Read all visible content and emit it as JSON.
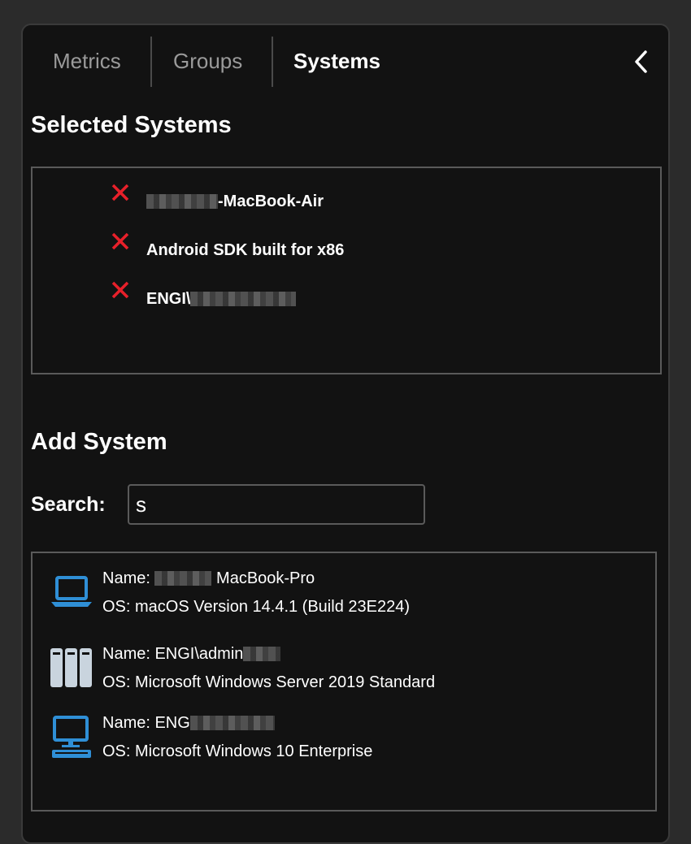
{
  "tabs": [
    {
      "label": "Metrics",
      "active": false
    },
    {
      "label": "Groups",
      "active": false
    },
    {
      "label": "Systems",
      "active": true
    }
  ],
  "selected": {
    "title": "Selected Systems",
    "items": [
      {
        "prefix": "",
        "suffix": "-MacBook-Air"
      },
      {
        "prefix": "Android SDK built for x86",
        "suffix": ""
      },
      {
        "prefix": "ENGI\\",
        "suffix": ""
      }
    ]
  },
  "add": {
    "title": "Add System",
    "search_label": "Search:",
    "search_value": "s"
  },
  "results": [
    {
      "name_label": "Name:",
      "name_prefix": "",
      "name_suffix": "MacBook-Pro",
      "os_label": "OS:",
      "os": "macOS Version 14.4.1 (Build 23E224)",
      "icon": "laptop-icon"
    },
    {
      "name_label": "Name:",
      "name_prefix": "ENGI\\admin",
      "name_suffix": "",
      "os_label": "OS:",
      "os": "Microsoft Windows Server 2019 Standard",
      "icon": "server-icon"
    },
    {
      "name_label": "Name:",
      "name_prefix": "ENG",
      "name_suffix": "",
      "os_label": "OS:",
      "os": "Microsoft Windows 10 Enterprise",
      "icon": "desktop-icon"
    }
  ],
  "colors": {
    "accent_blue": "#2f8fd6",
    "remove_red": "#e8202a",
    "server_gray": "#c9d4de"
  }
}
